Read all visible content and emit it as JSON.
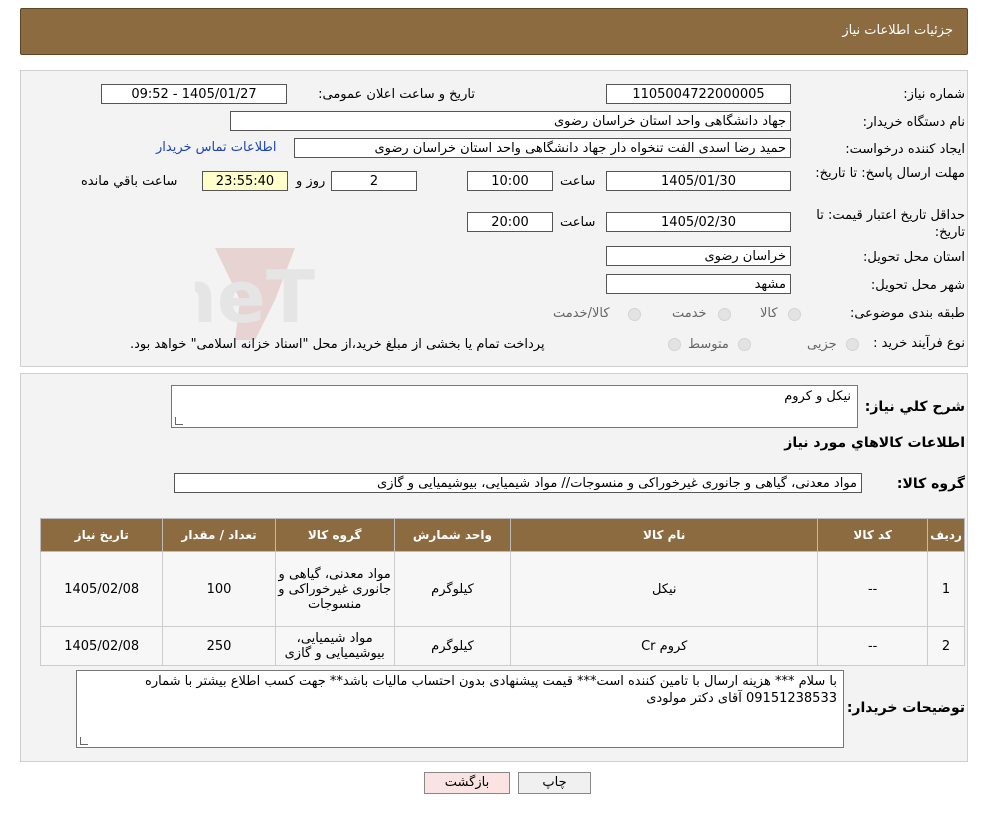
{
  "header": {
    "title": "جزئیات اطلاعات نیاز"
  },
  "form": {
    "need_number_label": "شماره نیاز:",
    "need_number": "1105004722000005",
    "announce_label": "تاریخ و ساعت اعلان عمومی:",
    "announce_value": "1405/01/27 - 09:52",
    "buyer_org_label": "نام دستگاه خریدار:",
    "buyer_org": "جهاد دانشگاهی واحد استان خراسان رضوی",
    "creator_label": "ایجاد کننده درخواست:",
    "creator": "حمید رضا اسدی الفت تنخواه دار جهاد دانشگاهی واحد استان خراسان رضوی",
    "contact_link": "اطلاعات تماس خریدار",
    "deadline_label": "مهلت ارسال پاسخ: تا تاریخ:",
    "deadline_date": "1405/01/30",
    "time_label": "ساعت",
    "deadline_time": "10:00",
    "days_value": "2",
    "days_label": "روز و",
    "remaining_value": "23:55:40",
    "remaining_label": "ساعت باقي مانده",
    "validity_label": "حداقل تاریخ اعتبار قیمت: تا تاریخ:",
    "validity_date": "1405/02/30",
    "validity_time": "20:00",
    "province_label": "استان محل تحویل:",
    "province": "خراسان رضوی",
    "city_label": "شهر محل تحویل:",
    "city": "مشهد",
    "category_label": "طبقه بندی موضوعی:",
    "category_options": [
      "کالا",
      "خدمت",
      "کالا/خدمت"
    ],
    "process_label": "نوع فرآیند خرید :",
    "process_options": [
      "جزیی",
      "متوسط"
    ],
    "process_note": "پرداخت تمام یا بخشی از مبلغ خرید،از محل \"اسناد خزانه اسلامی\" خواهد بود."
  },
  "details": {
    "summary_label": "شرح کلي نياز:",
    "summary": "نیکل و کروم",
    "items_title": "اطلاعات کالاهاي مورد نياز",
    "group_label": "گروه کالا:",
    "group_value": "مواد معدنی، گیاهی و جانوری غیرخوراکی و منسوجات// مواد شیمیایی، بیوشیمیایی و  گازی",
    "table": {
      "headers": [
        "ردیف",
        "کد کالا",
        "نام کالا",
        "واحد شمارش",
        "گروه کالا",
        "تعداد / مقدار",
        "تاریخ نیاز"
      ],
      "rows": [
        [
          "1",
          "--",
          "نیکل",
          "کیلوگرم",
          "مواد معدنی، گیاهی و جانوری غیرخوراکی و منسوجات",
          "100",
          "1405/02/08"
        ],
        [
          "2",
          "--",
          "کروم Cr",
          "کیلوگرم",
          "مواد شیمیایی، بیوشیمیایی و گازی",
          "250",
          "1405/02/08"
        ]
      ]
    },
    "buyer_notes_label": "توضیحات خریدار:",
    "buyer_notes": "با سلام *** هزینه ارسال با تامین کننده است*** قیمت پیشنهادی بدون احتساب مالیات باشد** جهت کسب اطلاع بیشتر با شماره 09151238533 آقای دکتر مولودی"
  },
  "buttons": {
    "print": "چاپ",
    "back": "بازگشت"
  },
  "watermark_text": "AriaTender.neT",
  "colors": {
    "header_bg": "#8b6b3f",
    "link": "#1f44b5",
    "back_btn": "#fbe3e3"
  }
}
